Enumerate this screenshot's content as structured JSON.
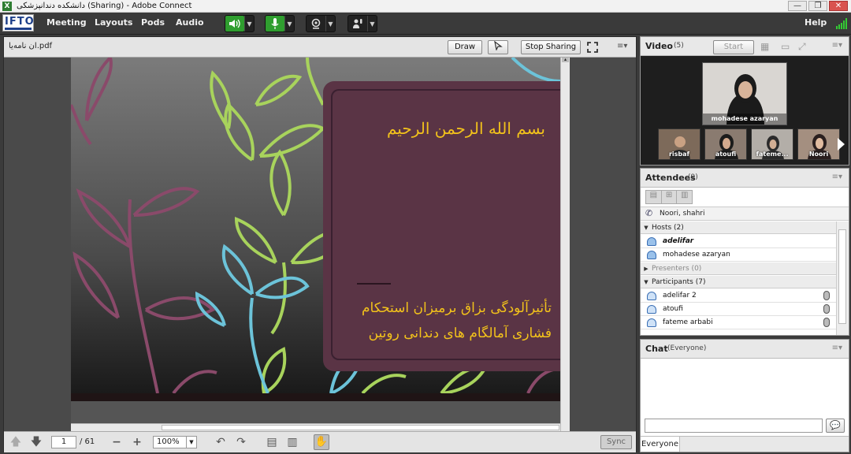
{
  "window": {
    "title": "دانشکده دندانپزشکی (Sharing) - Adobe Connect",
    "minimize": "—",
    "restore": "❐",
    "close": "✕"
  },
  "menubar": {
    "logo_text": "IFTO",
    "items": [
      "Meeting",
      "Layouts",
      "Pods",
      "Audio"
    ],
    "help": "Help"
  },
  "share_pod": {
    "filename": "ان نامه‌یا.pdf",
    "draw_label": "Draw",
    "stop_sharing_label": "Stop Sharing",
    "menu_icon": "≡▾"
  },
  "slide": {
    "bismillah": "بسم الله الرحمن الرحیم",
    "title_line1": "تأثیرآلودگی بزاق برمیزان استحکام",
    "title_line2": "فشاری آمالگام های دندانی روتین"
  },
  "share_footer": {
    "page_value": "1",
    "page_total": "/ 61",
    "zoom_value": "100%",
    "sync_label": "Sync"
  },
  "video_pod": {
    "title": "Video",
    "count": "(5)",
    "start_label": "Start",
    "main_name": "mohadese azaryan",
    "thumbs": [
      "risbaf",
      "atoufi",
      "fateme...",
      "Noori"
    ]
  },
  "attendees_pod": {
    "title": "Attendees",
    "count": "(9)",
    "speaker": "Noori, shahri",
    "hosts_label": "Hosts (2)",
    "hosts": [
      "adelifar",
      "mohadese azaryan"
    ],
    "presenters_label": "Presenters (0)",
    "participants_label": "Participants (7)",
    "participants": [
      "adelifar 2",
      "atoufi",
      "fateme arbabi"
    ]
  },
  "chat_pod": {
    "title": "Chat",
    "scope": "(Everyone)",
    "recipient": "Everyone",
    "input_placeholder": ""
  },
  "colors": {
    "slide_box": "#5a3445",
    "slide_text": "#f2c21b",
    "leaf_green": "#a8d35c",
    "leaf_blue": "#6cc3d9",
    "leaf_plum": "#8a4a6a"
  }
}
